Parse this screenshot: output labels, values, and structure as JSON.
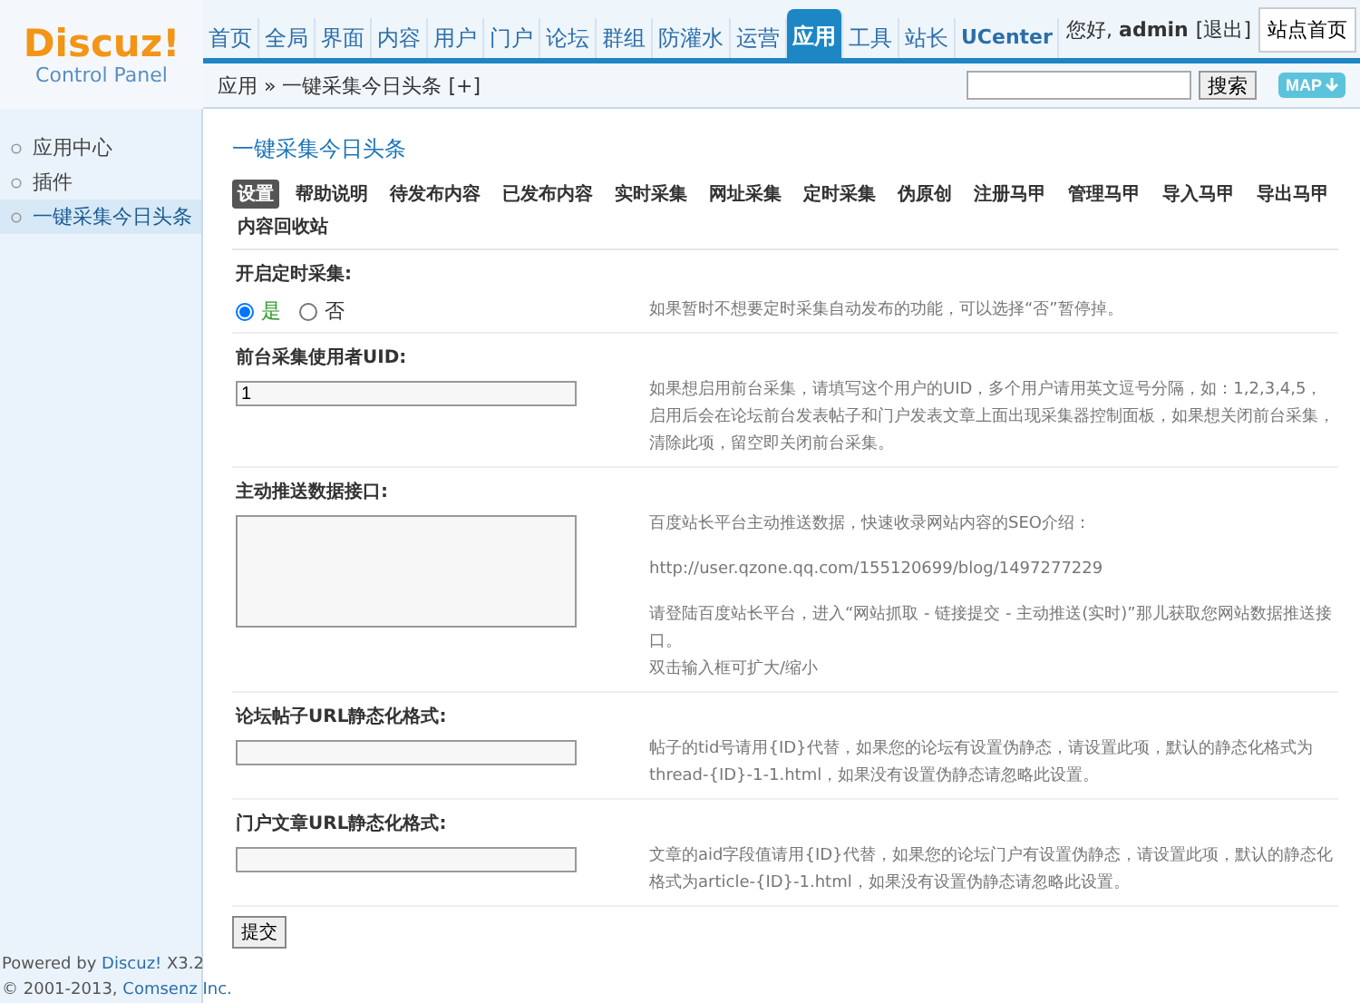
{
  "logo": {
    "name": "Discuz!",
    "subtitle": "Control Panel"
  },
  "nav": [
    {
      "label": "首页",
      "selected": false
    },
    {
      "label": "全局",
      "selected": false
    },
    {
      "label": "界面",
      "selected": false
    },
    {
      "label": "内容",
      "selected": false
    },
    {
      "label": "用户",
      "selected": false
    },
    {
      "label": "门户",
      "selected": false
    },
    {
      "label": "论坛",
      "selected": false
    },
    {
      "label": "群组",
      "selected": false
    },
    {
      "label": "防灌水",
      "selected": false
    },
    {
      "label": "运营",
      "selected": false
    },
    {
      "label": "应用",
      "selected": true
    },
    {
      "label": "工具",
      "selected": false
    },
    {
      "label": "站长",
      "selected": false
    },
    {
      "label": "UCenter",
      "selected": false
    }
  ],
  "user": {
    "greeting": "您好,",
    "name": "admin",
    "logout": "[退出]",
    "home_button": "站点首页"
  },
  "breadcrumb": {
    "items": [
      "应用",
      "一键采集今日头条"
    ],
    "separator": "»",
    "add": "[+]"
  },
  "search": {
    "button": "搜索",
    "map_button": "MAP"
  },
  "sidebar": {
    "items": [
      {
        "label": "应用中心",
        "selected": false
      },
      {
        "label": "插件",
        "selected": false
      },
      {
        "label": "一键采集今日头条",
        "selected": true
      }
    ],
    "footer": [
      {
        "prefix": "Powered by",
        "link": "Discuz!",
        "suffix": "X3.2"
      },
      {
        "prefix": "© 2001-2013,",
        "link": "Comsenz Inc."
      }
    ]
  },
  "page_title": "一键采集今日头条",
  "tabs": [
    {
      "label": "设置",
      "selected": true
    },
    {
      "label": "帮助说明",
      "selected": false
    },
    {
      "label": "待发布内容",
      "selected": false
    },
    {
      "label": "已发布内容",
      "selected": false
    },
    {
      "label": "实时采集",
      "selected": false
    },
    {
      "label": "网址采集",
      "selected": false
    },
    {
      "label": "定时采集",
      "selected": false
    },
    {
      "label": "伪原创",
      "selected": false
    },
    {
      "label": "注册马甲",
      "selected": false
    },
    {
      "label": "管理马甲",
      "selected": false
    },
    {
      "label": "导入马甲",
      "selected": false
    },
    {
      "label": "导出马甲",
      "selected": false
    },
    {
      "label": "内容回收站",
      "selected": false
    }
  ],
  "settings": [
    {
      "kind": "radio",
      "label": "开启定时采集:",
      "options": [
        {
          "label": "是",
          "selected": true
        },
        {
          "label": "否",
          "selected": false
        }
      ],
      "help": [
        [
          "如果暂时不想要定时采集自动发布的功能，可以选择“否”暂停掉。"
        ]
      ]
    },
    {
      "kind": "text",
      "label": "前台采集使用者UID:",
      "value": "1",
      "help": [
        [
          "如果想启用前台采集，请填写这个用户的UID，多个用户请用英文逗号分隔，如：1,2,3,4,5，启用后会在论坛前台发表帖子和门户发表文章上面出现采集器控制面板，如果想关闭前台采集，清除此项，留空即关闭前台采集。"
        ]
      ]
    },
    {
      "kind": "textarea",
      "label": "主动推送数据接口:",
      "help": [
        [
          "百度站长平台主动推送数据，快速收录网站内容的SEO介绍："
        ],
        [
          "http://user.qzone.qq.com/155120699/blog/1497277229"
        ],
        [
          "请登陆百度站长平台，进入“网站抓取 - 链接提交 - 主动推送(实时)”那儿获取您网站数据推送接口。",
          "双击输入框可扩大/缩小"
        ]
      ]
    },
    {
      "kind": "text",
      "label": "论坛帖子URL静态化格式:",
      "help": [
        [
          "帖子的tid号请用{ID}代替，如果您的论坛有设置伪静态，请设置此项，默认的静态化格式为thread-{ID}-1-1.html，如果没有设置伪静态请忽略此设置。"
        ]
      ]
    },
    {
      "kind": "text",
      "label": "门户文章URL静态化格式:",
      "help": [
        [
          "文章的aid字段值请用{ID}代替，如果您的论坛门户有设置伪静态，请设置此项，默认的静态化格式为article-{ID}-1.html，如果没有设置伪静态请忽略此设置。"
        ]
      ]
    }
  ],
  "submit": "提交"
}
